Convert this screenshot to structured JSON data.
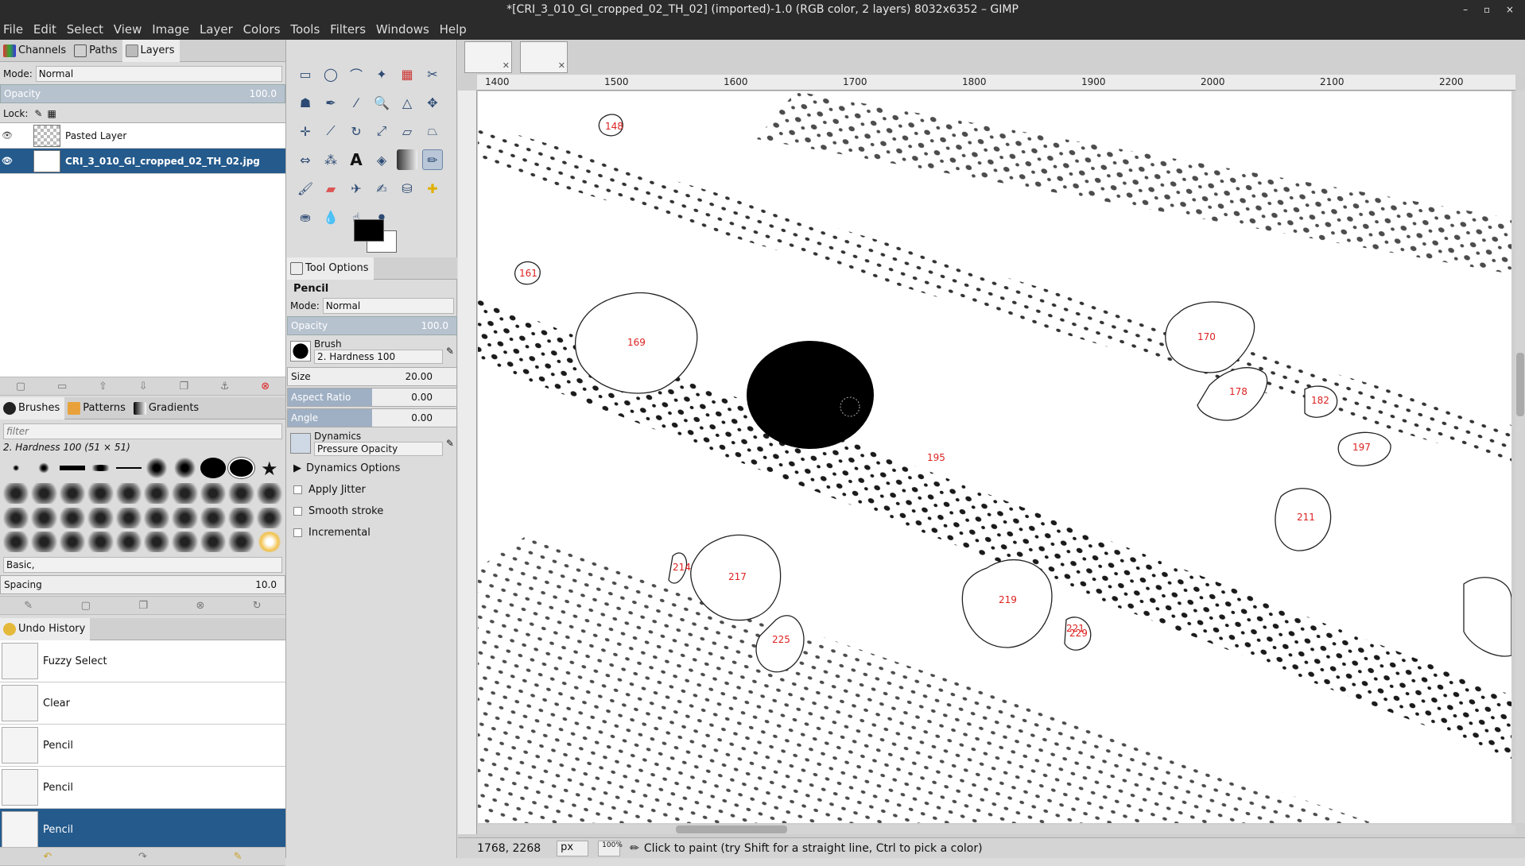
{
  "titlebar": {
    "title": "*[CRI_3_010_GI_cropped_02_TH_02] (imported)-1.0 (RGB color, 2 layers) 8032x6352 – GIMP"
  },
  "menubar": [
    "File",
    "Edit",
    "Select",
    "View",
    "Image",
    "Layer",
    "Colors",
    "Tools",
    "Filters",
    "Windows",
    "Help"
  ],
  "layers_dock": {
    "tabs": [
      "Channels",
      "Paths",
      "Layers"
    ],
    "mode_label": "Mode:",
    "mode_value": "Normal",
    "opacity_label": "Opacity",
    "opacity_value": "100.0",
    "lock_label": "Lock:",
    "layers": [
      {
        "name": "Pasted Layer"
      },
      {
        "name": "CRI_3_010_GI_cropped_02_TH_02.jpg"
      }
    ]
  },
  "brushes_dock": {
    "tabs": [
      "Brushes",
      "Patterns",
      "Gradients"
    ],
    "filter_placeholder": "filter",
    "current_brush": "2. Hardness 100 (51 × 51)",
    "preset": "Basic,",
    "spacing_label": "Spacing",
    "spacing_value": "10.0"
  },
  "history_dock": {
    "tab": "Undo History",
    "items": [
      "Fuzzy Select",
      "Clear",
      "Pencil",
      "Pencil",
      "Pencil"
    ]
  },
  "tool_options": {
    "tab": "Tool Options",
    "tool_name": "Pencil",
    "mode_label": "Mode:",
    "mode_value": "Normal",
    "opacity_label": "Opacity",
    "opacity_value": "100.0",
    "brush_label": "Brush",
    "brush_value": "2. Hardness 100",
    "size_label": "Size",
    "size_value": "20.00",
    "aspect_label": "Aspect Ratio",
    "aspect_value": "0.00",
    "angle_label": "Angle",
    "angle_value": "0.00",
    "dynamics_label": "Dynamics",
    "dynamics_value": "Pressure Opacity",
    "dynamics_options": "Dynamics Options",
    "apply_jitter": "Apply Jitter",
    "smooth_stroke": "Smooth stroke",
    "incremental": "Incremental"
  },
  "ruler": [
    "1400",
    "1500",
    "1600",
    "1700",
    "1800",
    "1900",
    "2000",
    "2100",
    "2200"
  ],
  "canvas_labels": [
    "148",
    "161",
    "169",
    "170",
    "178",
    "182",
    "195",
    "197",
    "211",
    "214",
    "217",
    "219",
    "221",
    "225",
    "229"
  ],
  "statusbar": {
    "coords": "1768, 2268",
    "unit": "px",
    "zoom": "100%",
    "message": "Click to paint (try Shift for a straight line, Ctrl to pick a color)"
  }
}
